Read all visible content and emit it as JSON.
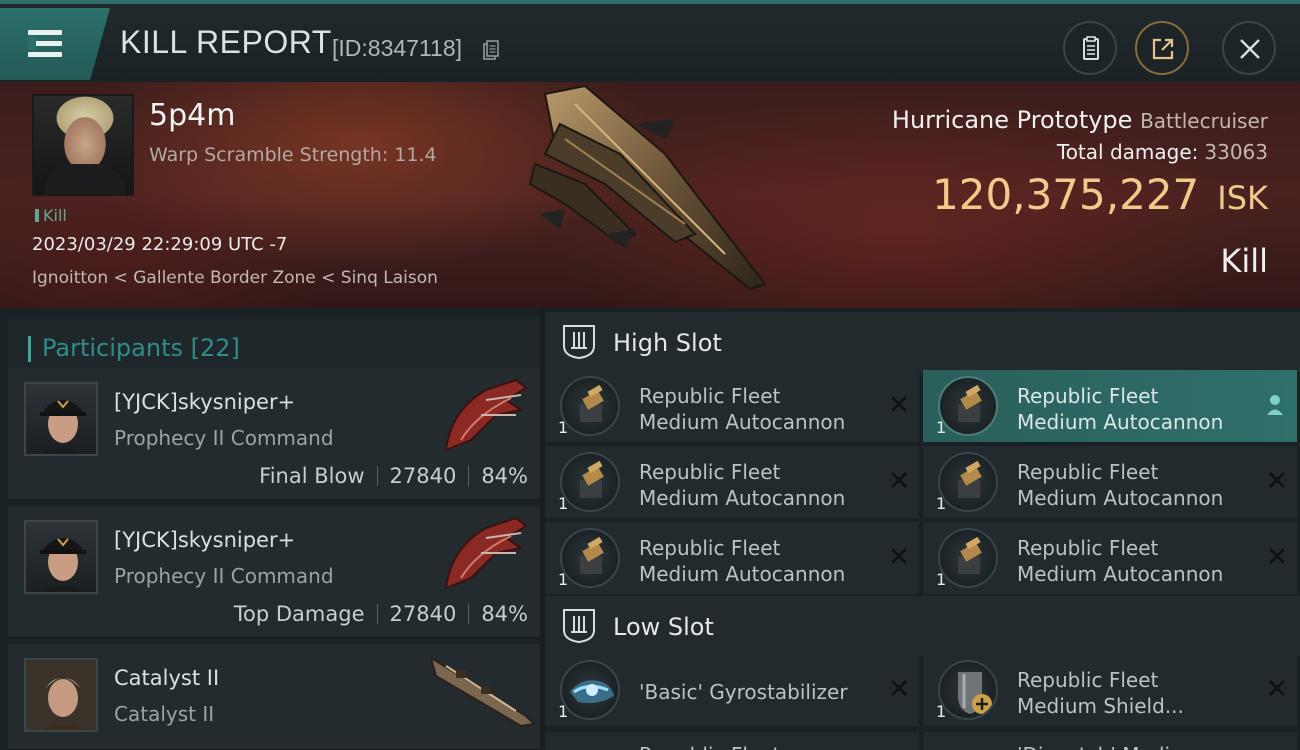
{
  "header": {
    "title": "KILL REPORT",
    "report_id": "[ID:8347118]",
    "icons": [
      "menu-icon",
      "copy-icon",
      "clipboard-icon",
      "share-icon",
      "close-icon"
    ]
  },
  "victim": {
    "name": "5p4m",
    "warp_scramble": "Warp Scramble Strength: 11.4",
    "badge": "Kill",
    "datetime": "2023/03/29 22:29:09 UTC -7",
    "location": "Ignoitton < Gallente Border Zone < Sinq Laison",
    "ship_name": "Hurricane Prototype",
    "ship_class": "Battlecruiser",
    "total_damage_label": "Total damage:",
    "total_damage_value": "33063",
    "isk_value": "120,375,227",
    "isk_unit": "ISK",
    "result": "Kill"
  },
  "participants": {
    "label": "Participants",
    "count": "[22]",
    "items": [
      {
        "name": "[YJCK]skysniper+",
        "ship": "Prophecy II Command",
        "role": "Final Blow",
        "damage": "27840",
        "percent": "84%"
      },
      {
        "name": "[YJCK]skysniper+",
        "ship": "Prophecy II Command",
        "role": "Top Damage",
        "damage": "27840",
        "percent": "84%"
      },
      {
        "name": "Catalyst II",
        "ship": "Catalyst II"
      }
    ]
  },
  "high_slot": {
    "label": "High Slot",
    "modules": [
      {
        "line1": "Republic Fleet",
        "line2": "Medium Autocannon",
        "qty": "1"
      },
      {
        "line1": "Republic Fleet",
        "line2": "Medium Autocannon",
        "qty": "1"
      },
      {
        "line1": "Republic Fleet",
        "line2": "Medium Autocannon",
        "qty": "1"
      },
      {
        "line1": "Republic Fleet",
        "line2": "Medium Autocannon",
        "qty": "1"
      },
      {
        "line1": "Republic Fleet",
        "line2": "Medium Autocannon",
        "qty": "1"
      },
      {
        "line1": "Republic Fleet",
        "line2": "Medium Autocannon",
        "qty": "1"
      }
    ]
  },
  "low_slot": {
    "label": "Low Slot",
    "modules": [
      {
        "line1": "'Basic' Gyrostabilizer",
        "qty": "1"
      },
      {
        "line1": "Republic Fleet",
        "line2": "Medium Shield...",
        "qty": "1"
      },
      {
        "line1": "Republic Fleet",
        "qty": ""
      },
      {
        "line1": "'Dispatch' Medium",
        "qty": ""
      }
    ]
  },
  "colors": {
    "accent": "#2f8d88",
    "isk": "#f1c98b",
    "active_row": "#2f706b"
  }
}
